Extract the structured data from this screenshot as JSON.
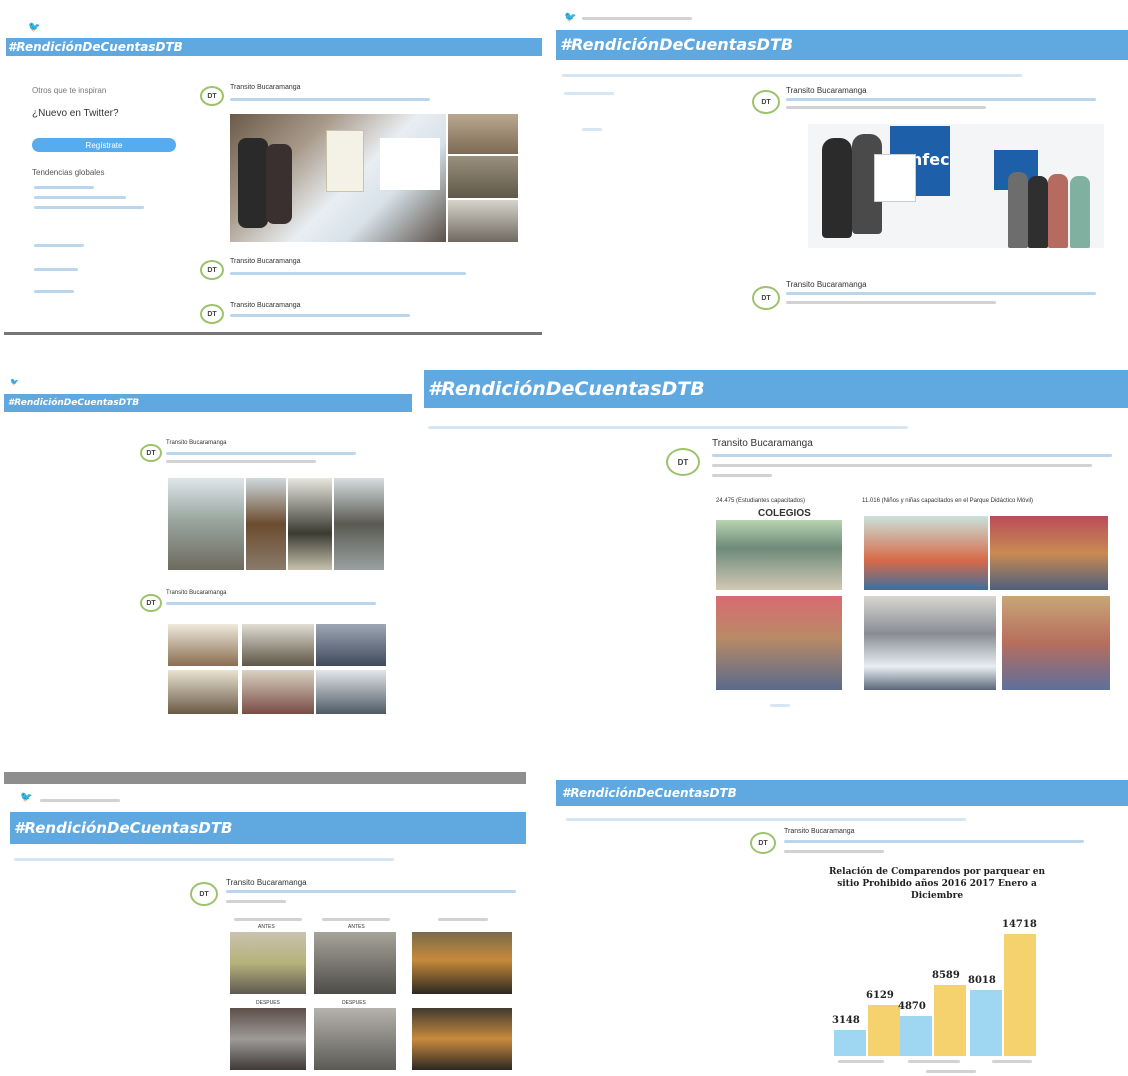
{
  "hashtag": "#RendiciónDeCuentasDTB",
  "author_name": "Transito Bucaramanga",
  "avatar_initials": "DT",
  "colors": {
    "twitter_blue": "#55acee",
    "hashtag_bar": "#5fa8e0",
    "bar_2016": "#9fd6f2",
    "bar_2017": "#f5d26e"
  },
  "sidebar": {
    "who_to_follow": "Otros que te inspiran",
    "new_on_twitter": "¿Nuevo en Twitter?",
    "signup_label": "Regístrate",
    "trends": "Tendencias globales"
  },
  "panel_5": {
    "labels_top": [
      "24.475 (Estudiantes capacitados)",
      "11.016 (Niños y niñas capacitados en el Parque Didáctico Móvil)"
    ],
    "colegios": "COLEGIOS"
  },
  "panel_7": {
    "labels": [
      "ANTES",
      "ANTES",
      "DESPUES",
      "DESPUES"
    ]
  },
  "chart_data": {
    "type": "bar",
    "title": "Relación de Comparendos por parquear en sitio Prohibido años 2016 2017 Enero a Diciembre",
    "categories": [
      "",
      "",
      ""
    ],
    "series": [
      {
        "values": [
          3148,
          4870,
          8018
        ]
      },
      {
        "values": [
          6129,
          8589,
          14718
        ]
      }
    ],
    "ylim": [
      0,
      15500
    ],
    "grid": false,
    "value_labels": [
      "3148",
      "6129",
      "4870",
      "8589",
      "8018",
      "14718"
    ]
  }
}
